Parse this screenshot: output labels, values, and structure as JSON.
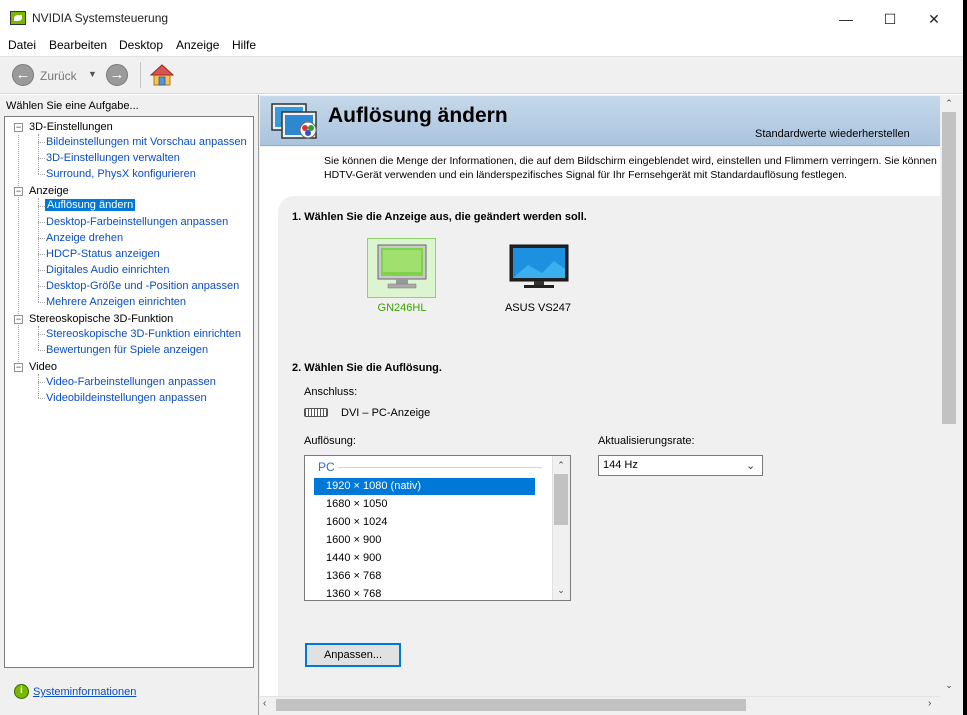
{
  "window": {
    "title": "NVIDIA Systemsteuerung",
    "controls": {
      "minimize": "—",
      "maximize": "☐",
      "close": "✕"
    }
  },
  "menu": [
    "Datei",
    "Bearbeiten",
    "Desktop",
    "Anzeige",
    "Hilfe"
  ],
  "toolbar": {
    "back_label": "Zurück",
    "back_icon": "arrow-left-icon",
    "forward_icon": "arrow-right-icon",
    "home_icon": "home-icon"
  },
  "sidebar": {
    "header": "Wählen Sie eine Aufgabe...",
    "categories": [
      {
        "label": "3D-Einstellungen",
        "toggle": "−",
        "items": [
          "Bildeinstellungen mit Vorschau anpassen",
          "3D-Einstellungen verwalten",
          "Surround, PhysX konfigurieren"
        ]
      },
      {
        "label": "Anzeige",
        "toggle": "−",
        "items": [
          "Auflösung ändern",
          "Desktop-Farbeinstellungen anpassen",
          "Anzeige drehen",
          "HDCP-Status anzeigen",
          "Digitales Audio einrichten",
          "Desktop-Größe und -Position anpassen",
          "Mehrere Anzeigen einrichten"
        ]
      },
      {
        "label": "Stereoskopische 3D-Funktion",
        "toggle": "−",
        "items": [
          "Stereoskopische 3D-Funktion einrichten",
          "Bewertungen für Spiele anzeigen"
        ]
      },
      {
        "label": "Video",
        "toggle": "−",
        "items": [
          "Video-Farbeinstellungen anpassen",
          "Videobildeinstellungen anpassen"
        ]
      }
    ],
    "selected_item": "Auflösung ändern",
    "footer_link": "Systeminformationen"
  },
  "main": {
    "title": "Auflösung ändern",
    "restore_defaults": "Standardwerte wiederherstellen",
    "description_line1": "Sie können die Menge der Informationen, die auf dem Bildschirm eingeblendet wird, einstellen und Flimmern verringern. Sie können",
    "description_line2": "HDTV-Gerät verwenden und ein länderspezifisches Signal für Ihr Fernsehgerät mit Standardauflösung festlegen.",
    "section1": "1. Wählen Sie die Anzeige aus, die geändert werden soll.",
    "displays": [
      {
        "name": "GN246HL",
        "selected": true
      },
      {
        "name": "ASUS VS247",
        "selected": false
      }
    ],
    "section2": "2. Wählen Sie die Auflösung.",
    "connection_label": "Anschluss:",
    "connection_value": "DVI – PC-Anzeige",
    "resolution_label": "Auflösung:",
    "resolution_group": "PC",
    "resolutions": [
      "1920 × 1080 (nativ)",
      "1680 × 1050",
      "1600 × 1024",
      "1600 × 900",
      "1440 × 900",
      "1366 × 768",
      "1360 × 768"
    ],
    "selected_resolution": "1920 × 1080 (nativ)",
    "refresh_label": "Aktualisierungsrate:",
    "refresh_value": "144 Hz",
    "adjust_button": "Anpassen..."
  },
  "colors": {
    "accent": "#0078d7",
    "nvidia_green": "#76b900",
    "link": "#0a4fbf",
    "header_band": "#b8cfe6"
  }
}
